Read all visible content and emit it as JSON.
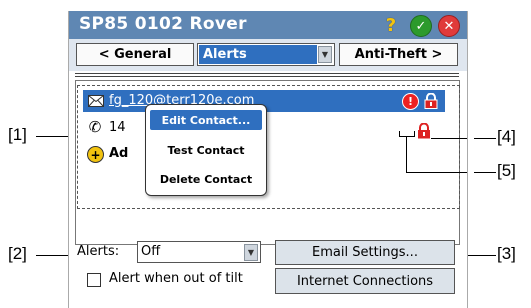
{
  "window": {
    "title": "SP85 0102 Rover",
    "help_icon": "question-mark-icon",
    "ok_icon": "checkmark-icon",
    "close_icon": "close-x-icon"
  },
  "nav": {
    "prev_label": "< General",
    "tab_value": "Alerts",
    "next_label": "Anti-Theft >"
  },
  "contacts": [
    {
      "icon": "envelope-icon",
      "text": "fg_120@terr120e.com",
      "selected": true
    },
    {
      "icon": "phone-icon",
      "text": "14"
    },
    {
      "icon": "plus-circle-icon",
      "text": "Ad"
    }
  ],
  "context_menu": {
    "items": [
      "Edit Contact...",
      "Test Contact",
      "Delete Contact"
    ]
  },
  "alerts": {
    "label": "Alerts:",
    "value": "Off"
  },
  "buttons": {
    "email_settings": "Email Settings...",
    "internet_connections": "Internet Connections"
  },
  "tilt": {
    "label": "Alert when out of tilt",
    "checked": false
  },
  "callouts": [
    "[1]",
    "[2]",
    "[3]",
    "[4]",
    "[5]"
  ],
  "colors": {
    "titlebar": "#5f87b3",
    "selection": "#2f6fbf",
    "alert_red": "#e22222"
  }
}
